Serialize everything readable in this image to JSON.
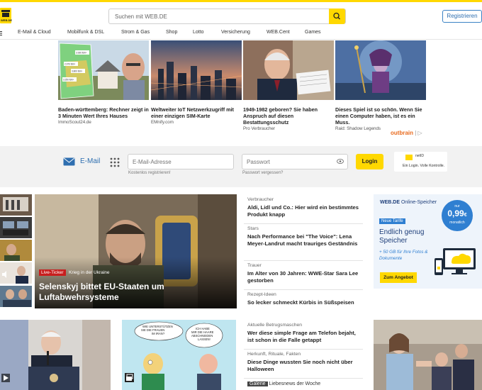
{
  "brand": {
    "logo_text": "WEB.DE"
  },
  "header": {
    "search_placeholder": "Suchen mit WEB.DE",
    "register_label": "Registrieren"
  },
  "nav": {
    "items": [
      "E-Mail & Cloud",
      "Mobilfunk & DSL",
      "Strom & Gas",
      "Shop",
      "Lotto",
      "Versicherung",
      "WEB.Cent",
      "Games"
    ]
  },
  "ads": [
    {
      "title": "Baden-württemberg: Rechner zeigt in 3 Minuten Wert Ihres Hauses",
      "source": "ImmoScout24.de"
    },
    {
      "title": "Weltweiter IoT Netzwerkzugriff mit einer einzigen SIM-Karte",
      "source": "EMnify.com"
    },
    {
      "title": "1949-1982 geboren? Sie haben Anspruch auf diesen Bestattungsschutz",
      "source": "Pro Verbraucher"
    },
    {
      "title": "Dieses Spiel ist so schön. Wenn Sie einen Computer haben, ist es ein Muss.",
      "source": "Raid: Shadow Legends"
    }
  ],
  "ad_map_labels": [
    "3.930 €/m²",
    "2.970 €/m²",
    "3.800 €/m²",
    "3.250 €/m²"
  ],
  "outbrain_label": "outbrain",
  "login": {
    "mail_label": "E-Mail",
    "email_placeholder": "E-Mail-Adresse",
    "password_placeholder": "Passwort",
    "email_hint": "Kostenlos registrieren!",
    "password_hint": "Passwort vergessen?",
    "login_button": "Login",
    "netid_logo": "netID",
    "netid_text": "Ein Login. Volle Kontrolle."
  },
  "hero": {
    "badge": "Live-Ticker",
    "kicker": "Krieg in der Ukraine",
    "title": "Selenskyj bittet EU-Staaten um Luftabwehrsysteme"
  },
  "news": [
    {
      "kicker": "Verbraucher",
      "headline": "Aldi, Lidl und Co.: Hier wird ein bestimmtes Produkt knapp"
    },
    {
      "kicker": "Stars",
      "headline": "Nach Performance bei \"The Voice\": Lena Meyer-Landrut macht trauriges Geständnis"
    },
    {
      "kicker": "Trauer",
      "headline": "Im Alter von 30 Jahren: WWE-Star Sara Lee gestorben"
    },
    {
      "kicker": "Rezept-Ideen",
      "headline": "So lecker schmeckt Kürbis in Süßspeisen"
    }
  ],
  "news_lower": [
    {
      "kicker": "Aktuelle Betrugsmaschen",
      "headline": "Wer diese simple Frage am Telefon bejaht, ist schon in die Falle getappt"
    },
    {
      "kicker": "Herkunft, Rituale, Fakten",
      "headline": "Diese Dinge wussten Sie noch nicht über Halloween"
    }
  ],
  "gallery": {
    "badge": "Galerie",
    "text": "Liebesnews der Woche"
  },
  "offer": {
    "brand": "WEB.DE",
    "brand_rest": " Online-Speicher",
    "price_prefix": "nur",
    "price": "0,99",
    "price_suffix": "€",
    "price_period": "monatlich",
    "tag": "Neue Tarife",
    "title": "Endlich genug Speicher",
    "subtitle": "+ 50 GB für Ihre Fotos & Dokumente",
    "button": "Zum Angebot"
  },
  "cartoon": {
    "bubble_left": "WIE UNTERSTÜTZEN SIE DIE FRAUEN IM IRAN?",
    "bubble_right": "ICH HABE MIR DIE HAARE ABSCHNEIDEN LASSEN!"
  },
  "colors": {
    "brand_yellow": "#ffd800",
    "link_blue": "#2f6fb0",
    "live_red": "#c81e1e"
  }
}
